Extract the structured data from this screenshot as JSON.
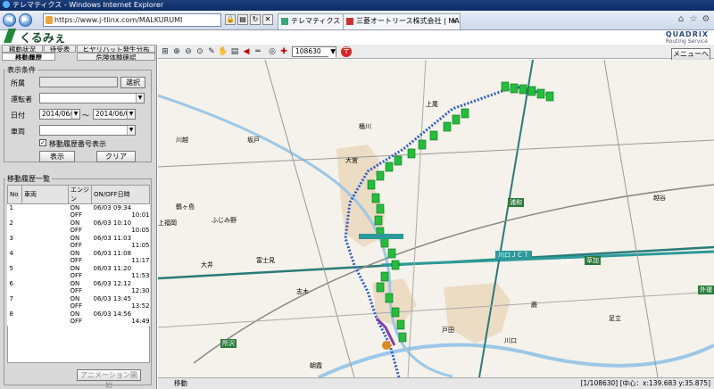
{
  "window": {
    "title": "テレマティクス - Windows Internet Explorer"
  },
  "browser": {
    "url": "https://www.j-tlinx.com/MALKURUMI",
    "tabs": [
      {
        "label": "テレマティクス"
      },
      {
        "label": "三菱オートリース株式会社 | MA..."
      }
    ]
  },
  "app": {
    "logo_text": "くるみぇ",
    "brand": "QUADRIX",
    "brand_sub": "Routing Service",
    "menu_button": "メニューへ"
  },
  "left_tabs": {
    "row1": [
      "稼動状況",
      "待受表",
      "ヒヤリハット発生分布"
    ],
    "row2": [
      "移動履歴",
      "危険体験確認"
    ]
  },
  "search": {
    "section_label": "表示条件",
    "office_label": "所属",
    "office_options": [
      "",
      "",
      "",
      ""
    ],
    "select_button": "選択",
    "driver_label": "運転者",
    "driver_value": "",
    "date_label": "日付",
    "date_from": "2014/06/03",
    "date_sep": "〜",
    "date_to": "2014/06/03",
    "vehicle_label": "車両",
    "vehicle_value": "",
    "show_seq_label": "移動履歴番号表示",
    "show_button": "表示",
    "clear_button": "クリア"
  },
  "history": {
    "section_label": "移動履歴一覧",
    "columns": [
      "No",
      "車両",
      "エンジン",
      "ON/OFF日時"
    ],
    "rows": [
      {
        "no": "1",
        "car": "",
        "engine": "ON",
        "time": "06/03 09:34"
      },
      {
        "no": "",
        "car": "",
        "engine": "OFF",
        "time": "10:01"
      },
      {
        "no": "2",
        "car": "",
        "engine": "ON",
        "time": "06/03 10:10"
      },
      {
        "no": "",
        "car": "",
        "engine": "OFF",
        "time": "10:05"
      },
      {
        "no": "3",
        "car": "",
        "engine": "ON",
        "time": "06/03 11:03"
      },
      {
        "no": "",
        "car": "",
        "engine": "OFF",
        "time": "11:05"
      },
      {
        "no": "4",
        "car": "",
        "engine": "ON",
        "time": "06/03 11:08"
      },
      {
        "no": "",
        "car": "",
        "engine": "OFF",
        "time": "11:17"
      },
      {
        "no": "5",
        "car": "",
        "engine": "ON",
        "time": "06/03 11:20"
      },
      {
        "no": "",
        "car": "",
        "engine": "OFF",
        "time": "11:53"
      },
      {
        "no": "6",
        "car": "",
        "engine": "ON",
        "time": "06/03 12:12"
      },
      {
        "no": "",
        "car": "",
        "engine": "OFF",
        "time": "12:30"
      },
      {
        "no": "7",
        "car": "",
        "engine": "ON",
        "time": "06/03 13:45"
      },
      {
        "no": "",
        "car": "",
        "engine": "OFF",
        "time": "13:52"
      },
      {
        "no": "8",
        "car": "",
        "engine": "ON",
        "time": "06/03 14:56"
      },
      {
        "no": "",
        "car": "",
        "engine": "OFF",
        "time": "14:49"
      }
    ],
    "animation_button": "アニメーション開始"
  },
  "map": {
    "scale_value": "108630",
    "labels": [
      "川越",
      "ふじみ野",
      "富士見",
      "志木",
      "朝霞",
      "所沢",
      "川口",
      "浦和",
      "草加",
      "足立",
      "鶴ヶ島",
      "坂戸",
      "上福岡",
      "大井",
      "戸田",
      "蕨",
      "越谷",
      "桶川",
      "上尾",
      "大宮"
    ],
    "road_labels": [
      "川口ＪＣＴ",
      "草加",
      "外環"
    ]
  },
  "status": {
    "left": "移動",
    "coords": "[1/108630]  [中心：x:139.683 y:35.875]"
  }
}
